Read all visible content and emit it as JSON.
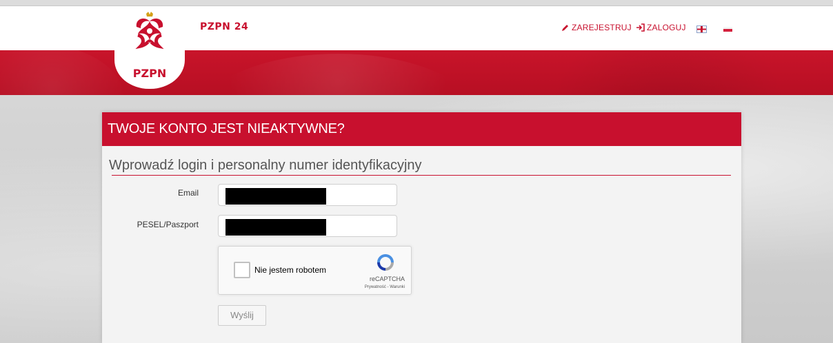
{
  "header": {
    "site_title": "PZPN 24",
    "logo_text": "PZPN",
    "nav": {
      "register_label": "ZAREJESTRUJ",
      "register_icon": "pencil-icon",
      "login_label": "ZALOGUJ",
      "login_icon": "sign-in-icon"
    },
    "languages": [
      "en-flag-icon",
      "pl-flag-icon"
    ]
  },
  "form": {
    "title": "TWOJE KONTO JEST NIEAKTYWNE?",
    "subtitle": "Wprowadź login i personalny numer identyfikacyjny",
    "email_label": "Email",
    "pesel_label": "PESEL/Paszport",
    "recaptcha": {
      "label": "Nie jestem robotem",
      "brand": "reCAPTCHA",
      "links": "Prywatność - Warunki"
    },
    "submit_label": "Wyślij"
  },
  "colors": {
    "brand_red": "#c8102e",
    "panel_bg": "#f3f3f3"
  }
}
